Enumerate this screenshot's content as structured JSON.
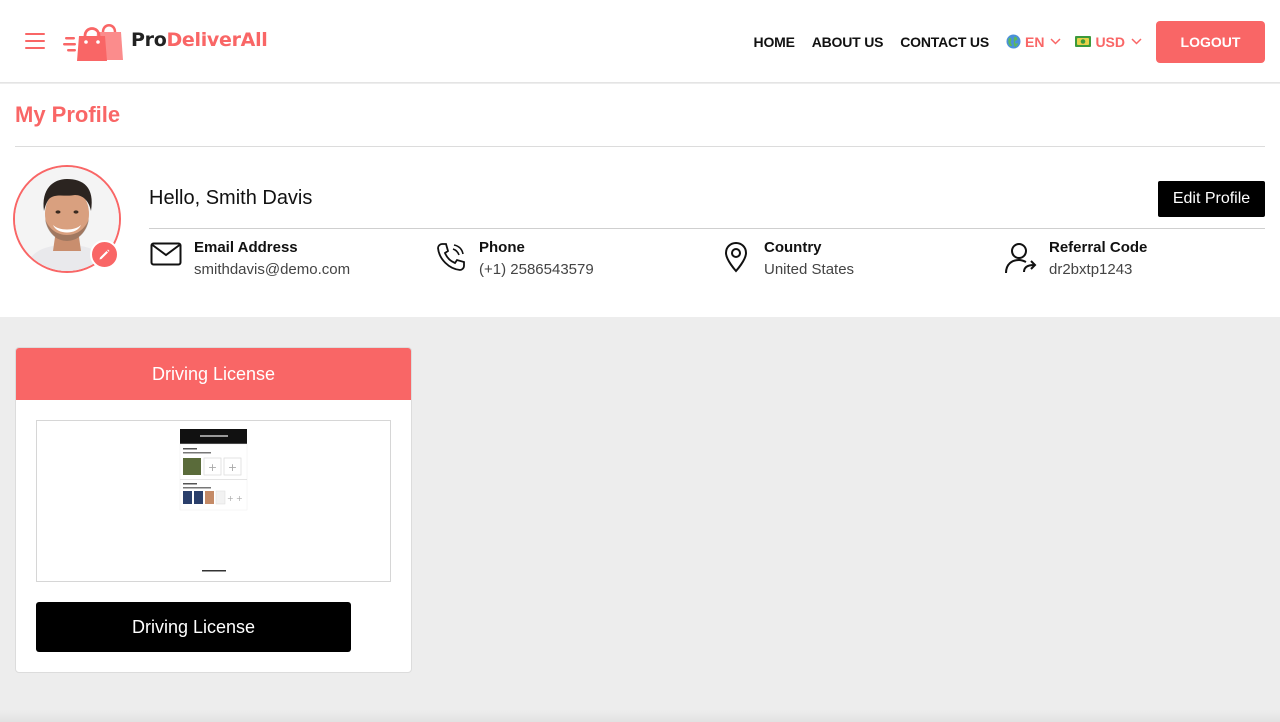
{
  "header": {
    "logo": {
      "part1": "Pro",
      "part2": "DeliverAll"
    },
    "nav": {
      "home": "HOME",
      "about": "ABOUT US",
      "contact": "CONTACT US",
      "language": "EN",
      "currency": "USD"
    },
    "logout_label": "LOGOUT"
  },
  "profile": {
    "page_title": "My Profile",
    "greeting": "Hello, Smith Davis",
    "edit_label": "Edit Profile",
    "fields": [
      {
        "label": "Email Address",
        "value": "smithdavis@demo.com",
        "icon": "mail-icon"
      },
      {
        "label": "Phone",
        "value": "(+1) 2586543579",
        "icon": "phone-icon"
      },
      {
        "label": "Country",
        "value": "United States",
        "icon": "location-pin-icon"
      },
      {
        "label": "Referral Code",
        "value": "dr2bxtp1243",
        "icon": "user-share-icon"
      }
    ]
  },
  "document_card": {
    "title": "Driving License",
    "button_label": "Driving License"
  },
  "colors": {
    "accent": "#f96666",
    "background": "#ededed"
  }
}
